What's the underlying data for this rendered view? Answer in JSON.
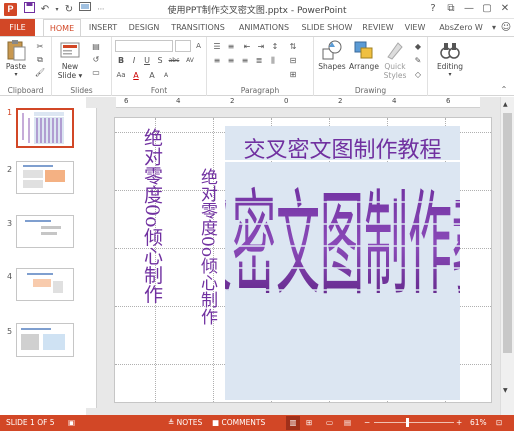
{
  "window": {
    "title": "使用PPT制作交叉密文图.pptx - PowerPoint",
    "app_icon_label": "P",
    "quick_access": [
      "save-icon",
      "undo-icon",
      "redo-icon",
      "slideshow-icon",
      "customize-icon"
    ],
    "controls": [
      "?",
      "⧉",
      "—",
      "▢",
      "✕"
    ]
  },
  "ribbon_tabs": {
    "file": "FILE",
    "home": "HOME",
    "insert": "INSERT",
    "design": "DESIGN",
    "transitions": "TRANSITIONS",
    "animations": "ANIMATIONS",
    "slideshow": "SLIDE SHOW",
    "review": "REVIEW",
    "view": "VIEW",
    "user": "AbsZero W"
  },
  "ribbon": {
    "clipboard": {
      "label": "Clipboard",
      "paste": "Paste"
    },
    "slides": {
      "label": "Slides",
      "new_slide_1": "New",
      "new_slide_2": "Slide"
    },
    "font": {
      "label": "Font",
      "bold": "B",
      "italic": "I",
      "underline": "U",
      "shadow": "S",
      "strike": "abc",
      "spacing": "AV",
      "case": "Aa",
      "color": "A",
      "grow": "A",
      "shrink": "A",
      "clear": "A"
    },
    "paragraph": {
      "label": "Paragraph"
    },
    "drawing": {
      "label": "Drawing",
      "shapes": "Shapes",
      "arrange": "Arrange",
      "quick_1": "Quick",
      "quick_2": "Styles"
    },
    "editing": {
      "label": "Editing"
    }
  },
  "ruler_top": [
    "6",
    "4",
    "2",
    "0",
    "2",
    "4",
    "6"
  ],
  "thumbnails": [
    {
      "num": "1",
      "selected": true
    },
    {
      "num": "2",
      "selected": false
    },
    {
      "num": "3",
      "selected": false
    },
    {
      "num": "4",
      "selected": false
    },
    {
      "num": "5",
      "selected": false
    }
  ],
  "slide": {
    "title": "交叉密文图制作教程",
    "vertical_1": "绝对零度0o倾心制作",
    "vertical_2": "绝对零度0o倾心制作",
    "cross_text": "交叉密文图制作教程",
    "accent_color": "#7030a0",
    "box_color": "#dce6f2"
  },
  "status": {
    "slide_info": "SLIDE 1 OF 5",
    "notes": "NOTES",
    "comments": "COMMENTS",
    "zoom": "61%",
    "bar_color": "#d24726"
  }
}
